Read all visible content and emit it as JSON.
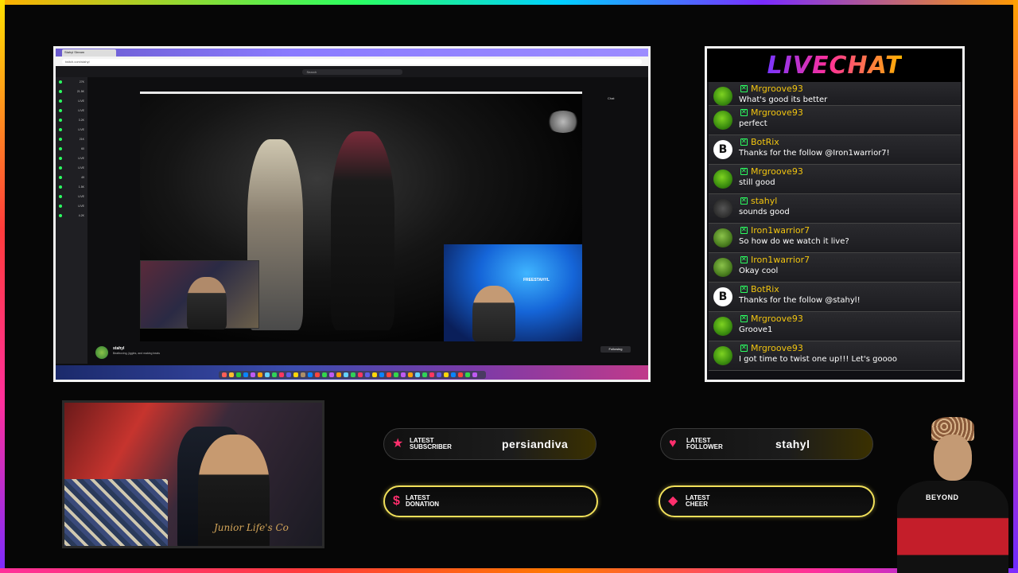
{
  "browser": {
    "tab_title": "Stahyl Stream",
    "url": "twitch.com/stahyl",
    "search_placeholder": "Search",
    "chat_tab": "Chat",
    "sidebar_counts": [
      "27K",
      "21.5K",
      "LIVE",
      "LIVE",
      "3.2K",
      "LIVE",
      "21K",
      "60",
      "LIVE",
      "LIVE",
      "49",
      "1.5K",
      "LIVE",
      "LIVE",
      "4.2K"
    ],
    "overlay_label": "FREESTAHYL",
    "streamer": "stahyl",
    "stream_description": "Beatboxing, jiggles, and making beats",
    "following_label": "Following"
  },
  "livechat": {
    "title": "LIVECHAT",
    "messages": [
      {
        "user": "Mrgroove93",
        "text": "What's good its better",
        "avatar": "groove"
      },
      {
        "user": "Mrgroove93",
        "text": "perfect",
        "avatar": "groove"
      },
      {
        "user": "BotRix",
        "text": "Thanks for the follow @Iron1warrior7!",
        "avatar": "bot"
      },
      {
        "user": "Mrgroove93",
        "text": "still good",
        "avatar": "groove"
      },
      {
        "user": "stahyl",
        "text": "sounds good",
        "avatar": "stahyl"
      },
      {
        "user": "Iron1warrior7",
        "text": "So how do we watch it live?",
        "avatar": "iron"
      },
      {
        "user": "Iron1warrior7",
        "text": "Okay cool",
        "avatar": "iron"
      },
      {
        "user": "BotRix",
        "text": "Thanks for the follow @stahyl!",
        "avatar": "bot"
      },
      {
        "user": "Mrgroove93",
        "text": "Groove1",
        "avatar": "groove"
      },
      {
        "user": "Mrgroove93",
        "text": "I got time to twist one up!!! Let's goooo",
        "avatar": "groove"
      }
    ]
  },
  "webcam": {
    "shirt_text": "Junior Life's Co"
  },
  "alerts": {
    "latest_subscriber": {
      "label_line1": "LATEST",
      "label_line2": "SUBSCRIBER",
      "value": "persiandiva",
      "icon": "star-icon"
    },
    "latest_follower": {
      "label_line1": "LATEST",
      "label_line2": "FOLLOWER",
      "value": "stahyl",
      "icon": "heart-icon"
    },
    "latest_donation": {
      "label_line1": "LATEST",
      "label_line2": "DONATION",
      "value": "",
      "icon": "dollar-icon"
    },
    "latest_cheer": {
      "label_line1": "LATEST",
      "label_line2": "CHEER",
      "value": "",
      "icon": "diamond-icon"
    }
  },
  "cutout": {
    "shirt_text": "BEYOND"
  },
  "colors": {
    "accent_pink": "#ff2f6d",
    "pill_outline": "#f1e05a",
    "username_gold": "#f1c40f",
    "badge_green": "#2bff61"
  }
}
